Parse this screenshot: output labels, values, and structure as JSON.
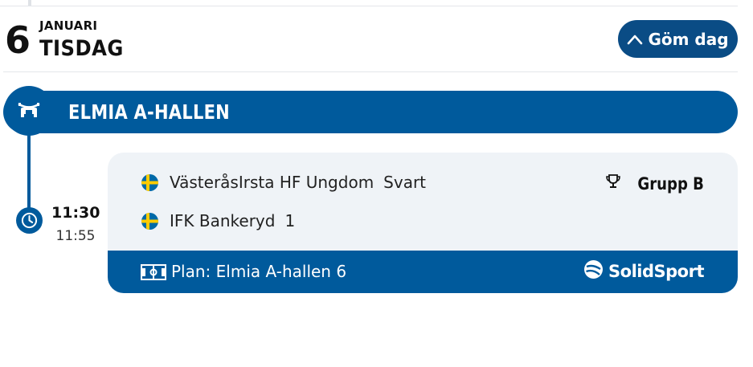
{
  "date": {
    "day": "6",
    "month": "JANUARI",
    "weekday": "TISDAG"
  },
  "hide_day_button": {
    "label": "Göm dag",
    "icon": "chevron-up-icon"
  },
  "venue": {
    "name": "ELMIA A-HALLEN",
    "icon": "arena-icon"
  },
  "match": {
    "start_time": "11:30",
    "end_time": "11:55",
    "home_team": {
      "flag": "sweden-flag-icon",
      "name": "VästeråsIrsta HF Ungdom",
      "detail": "Svart"
    },
    "away_team": {
      "flag": "sweden-flag-icon",
      "name": "IFK Bankeryd",
      "detail": "1"
    },
    "group": {
      "icon": "trophy-icon",
      "label": "Grupp B"
    },
    "plan": {
      "icon": "pitch-icon",
      "label": "Plan: Elmia A-hallen 6"
    },
    "stream": {
      "icon": "solidsport-logo-icon",
      "label": "SolidSport"
    }
  },
  "colors": {
    "primary_blue": "#005a9c",
    "dark_blue_button": "#0a4c85",
    "card_background": "#eff3f7",
    "flag_blue": "#006aa7",
    "flag_yellow": "#fecc00"
  }
}
